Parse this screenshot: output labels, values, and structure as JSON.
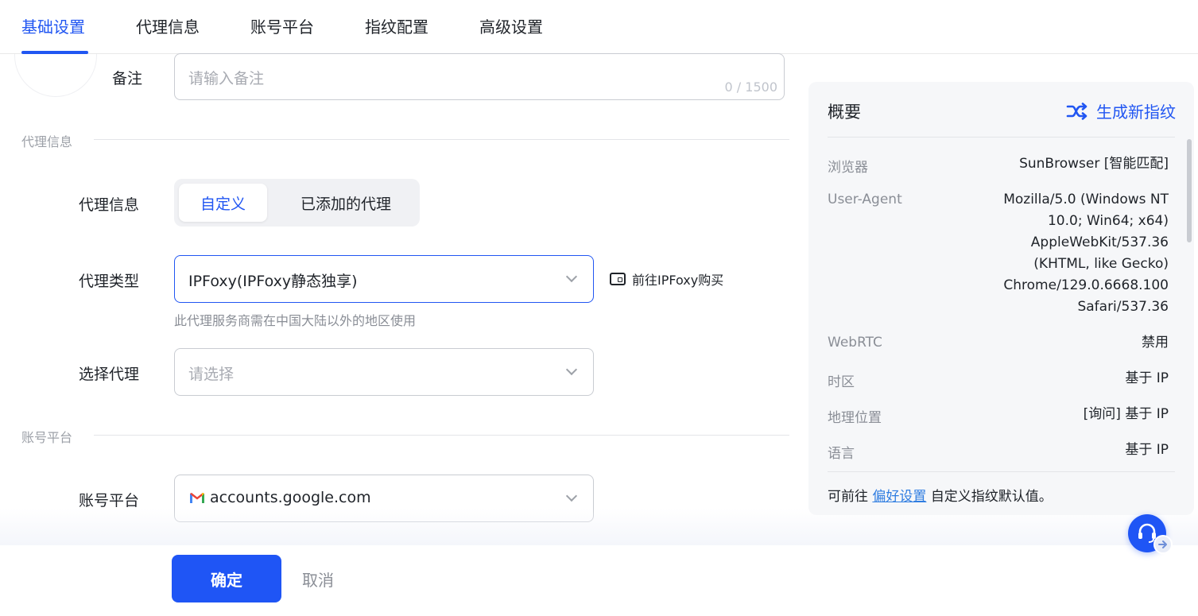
{
  "tabs": [
    {
      "label": "基础设置"
    },
    {
      "label": "代理信息"
    },
    {
      "label": "账号平台"
    },
    {
      "label": "指纹配置"
    },
    {
      "label": "高级设置"
    }
  ],
  "note": {
    "label": "备注",
    "placeholder": "请输入备注",
    "counter": "0 / 1500"
  },
  "proxy_section": {
    "title": "代理信息"
  },
  "proxy_info": {
    "label": "代理信息",
    "options": [
      "自定义",
      "已添加的代理"
    ],
    "selected": "自定义"
  },
  "proxy_type": {
    "label": "代理类型",
    "value": "IPFoxy(IPFoxy静态独享)",
    "buy_link": "前往IPFoxy购买",
    "hint": "此代理服务商需在中国大陆以外的地区使用"
  },
  "select_proxy": {
    "label": "选择代理",
    "placeholder": "请选择"
  },
  "account_section": {
    "title": "账号平台"
  },
  "account_platform": {
    "label": "账号平台",
    "value": "accounts.google.com"
  },
  "footer": {
    "confirm": "确定",
    "cancel": "取消"
  },
  "summary": {
    "title": "概要",
    "generate": "生成新指纹",
    "rows": [
      {
        "key": "浏览器",
        "value": "SunBrowser [智能匹配]"
      },
      {
        "key": "User-Agent",
        "value_lines": [
          "Mozilla/5.0 (Windows NT",
          "10.0; Win64; x64)",
          "AppleWebKit/537.36",
          "(KHTML, like Gecko)",
          "Chrome/129.0.6668.100",
          "Safari/537.36"
        ]
      },
      {
        "key": "WebRTC",
        "value": "禁用"
      },
      {
        "key": "时区",
        "value": "基于 IP"
      },
      {
        "key": "地理位置",
        "value": "[询问] 基于 IP"
      },
      {
        "key": "语言",
        "value": "基于 IP"
      }
    ],
    "footer_prefix": "可前往",
    "footer_link": "偏好设置",
    "footer_suffix": "自定义指纹默认值。"
  },
  "colors": {
    "accent": "#2156f2",
    "primary_button": "#1f55f5",
    "panel_bg": "#f6f7f9"
  },
  "icons": [
    "shuffle-icon",
    "wallet-icon",
    "gmail-icon",
    "chevron-down-icon",
    "headset-icon"
  ]
}
